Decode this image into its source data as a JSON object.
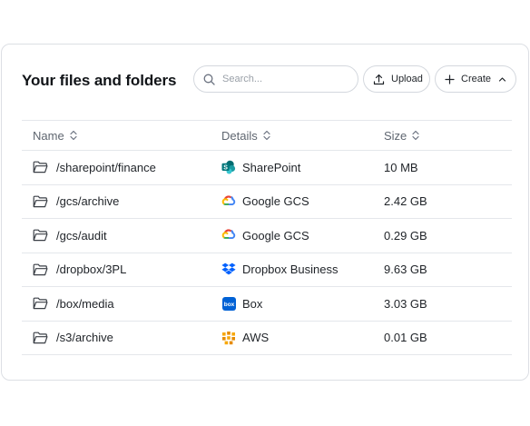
{
  "header": {
    "title": "Your files and folders",
    "search_placeholder": "Search...",
    "upload_label": "Upload",
    "create_label": "Create"
  },
  "table": {
    "columns": [
      "Name",
      "Details",
      "Size"
    ],
    "rows": [
      {
        "name": "/sharepoint/finance",
        "service": "SharePoint",
        "service_icon": "sharepoint-icon",
        "size": "10 MB"
      },
      {
        "name": "/gcs/archive",
        "service": "Google GCS",
        "service_icon": "google-cloud-icon",
        "size": "2.42 GB"
      },
      {
        "name": "/gcs/audit",
        "service": "Google GCS",
        "service_icon": "google-cloud-icon",
        "size": "0.29 GB"
      },
      {
        "name": "/dropbox/3PL",
        "service": "Dropbox Business",
        "service_icon": "dropbox-icon",
        "size": "9.63 GB"
      },
      {
        "name": "/box/media",
        "service": "Box",
        "service_icon": "box-icon",
        "size": "3.03 GB"
      },
      {
        "name": "/s3/archive",
        "service": "AWS",
        "service_icon": "aws-s3-icon",
        "size": "0.01 GB"
      }
    ]
  },
  "colors": {
    "sharepoint": "#0b7f7a",
    "dropbox": "#0061fe",
    "box": "#0061d5",
    "aws": "#f7a80d",
    "border": "#e4e7eb"
  }
}
